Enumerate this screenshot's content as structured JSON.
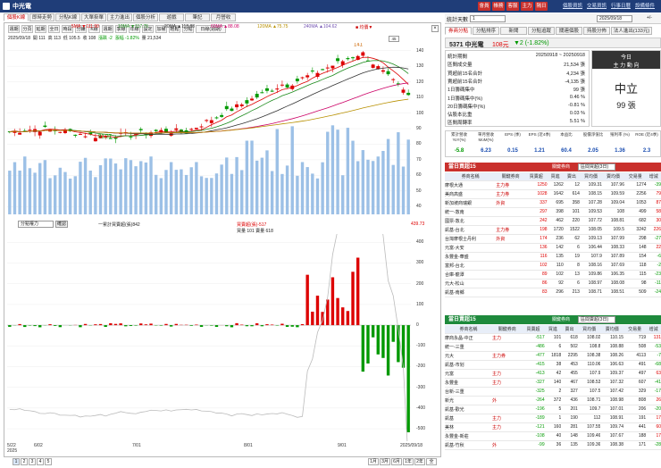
{
  "app": {
    "title": "中光電",
    "tabs_right": [
      "會員",
      "帳務",
      "客服",
      "主力",
      "隔日"
    ],
    "links": [
      "個股資訊",
      "交易資訊",
      "行事日曆",
      "設備條件"
    ]
  },
  "left": {
    "tabs": [
      "個股K線",
      "即時走勢",
      "分點K線",
      "大單掛單",
      "主力進出",
      "個股分析",
      "遊戲",
      "筆記",
      "月營收"
    ],
    "toolbar": [
      "週期",
      "分頁",
      "延期",
      "全日",
      "時段",
      "分鐘",
      "K線",
      "週期",
      "季線",
      "年線",
      "設定",
      "加權",
      "輕鬆",
      "分點",
      "日線(週期)"
    ],
    "ma": [
      {
        "t": "5MA ▼111.90",
        "c": "#d00"
      },
      {
        "t": "10MA ▼117.75",
        "c": "#1a8a1a"
      },
      {
        "t": "20MA ▲118.88",
        "c": "#333"
      },
      {
        "t": "60MA ▲88.08",
        "c": "#c06"
      },
      {
        "t": "120MA ▲75.75",
        "c": "#b89000"
      },
      {
        "t": "240MA ▲104.62",
        "c": "#7050b0"
      }
    ],
    "legend_extra": "■ 均價▼",
    "info": {
      "date": "2025/09/18",
      "open": "開 111",
      "high": "高 113",
      "low": "低 105.5",
      "close": "收 108",
      "change": "漲跌 -2",
      "pct": "漲幅 -1.82%",
      "vol": "量 21,534"
    },
    "zoom": "45",
    "peak_label": "141",
    "low_label": "91.37",
    "price_axis": [
      "140",
      "130",
      "120",
      "110",
      "100",
      "90",
      "80",
      "70",
      "60",
      "50",
      "40"
    ],
    "sub": {
      "sel": "分點權力",
      "btn": "確認",
      "legend1": "一累計買賣超(張)842",
      "legend2": "買賣超(張)-517",
      "legend3": "買量 101  賣量 618",
      "rlabel": "439.73"
    },
    "sub_axis": [
      "400",
      "300",
      "200",
      "100",
      "0",
      "-100",
      "-200",
      "-300",
      "-400",
      "-500"
    ],
    "x_labels": [
      "5/22\n2025",
      "6/02",
      "7/01",
      "8/01",
      "9/01",
      "2025/09/18"
    ],
    "pager": [
      "1",
      "2",
      "3",
      "4",
      "5"
    ],
    "bottom_btns": [
      "1月",
      "3月",
      "6月",
      "1年",
      "2年",
      "全"
    ]
  },
  "right": {
    "code_lbl": "統計天數",
    "code_val": "1",
    "date": "2025/09/18",
    "date_end": "+/-",
    "tabs": [
      "券商分點",
      "分點排序",
      "新聞",
      "分點追蹤",
      "關連個股",
      "持股分佈",
      "法人進出(133元)"
    ],
    "stock": {
      "name": "5371 中光電",
      "price": "108元",
      "chg": "▼2 (-1.82%)"
    },
    "stat_rows": [
      [
        "統計期間",
        "20250918 ~ 20250918"
      ],
      [
        "區間成交量",
        "21,534 張"
      ],
      [
        "買超前15名合計",
        "4,234 張"
      ],
      [
        "賣超前15名合計",
        "-4,135 張"
      ],
      [
        "1日籌碼集中",
        "99 張"
      ],
      [
        "1日籌碼集中(%)",
        "0.46 %"
      ],
      [
        "20日籌碼集中(%)",
        "-0.81 %"
      ],
      [
        "佔股本比重",
        "0.03 %"
      ],
      [
        "區間周轉率",
        "5.51 %"
      ]
    ],
    "today": {
      "h1": "今日",
      "h2": "主 力 動 向",
      "main": "中立",
      "sub": "99 張"
    },
    "kpi_h": [
      "累計營收 YoY(%)",
      "單月營收 MoM(%)",
      "EPS (季)",
      "EPS (近4季)",
      "本益比",
      "股價淨值比",
      "殖利率 (%)",
      "ROE (近4季)"
    ],
    "kpi_v": [
      "-5.8",
      "6.23",
      "0.15",
      "1.21",
      "60.4",
      "2.05",
      "1.36",
      "2.3"
    ],
    "buy": {
      "title": "當日買超15",
      "sel_lbl": "關鍵券商",
      "sel": "區間買超(3日)",
      "cols": [
        "券商名稱",
        "關鍵券商",
        "買賣超",
        "買進",
        "賣出",
        "買均價",
        "賣均價",
        "交易量",
        "增減"
      ],
      "rows": [
        [
          "摩根大通",
          "主力券",
          "1250",
          "1262",
          "12",
          "109.31",
          "107.96",
          "1274",
          "-39"
        ],
        [
          "美商高盛",
          "主力券",
          "1028",
          "1642",
          "614",
          "108.15",
          "109.59",
          "2256",
          "79"
        ],
        [
          "新加坡商瑞銀",
          "外資",
          "337",
          "695",
          "358",
          "107.28",
          "109.04",
          "1053",
          "87"
        ],
        [
          "統一-敦南",
          "",
          "297",
          "398",
          "101",
          "109.53",
          "108",
          "499",
          "58"
        ],
        [
          "國票-敦北",
          "",
          "242",
          "462",
          "220",
          "107.72",
          "108.81",
          "682",
          "30"
        ],
        [
          "凱基-台北",
          "主力券",
          "198",
          "1720",
          "1522",
          "108.05",
          "109.5",
          "3242",
          "226"
        ],
        [
          "台灣摩根士丹利",
          "外資",
          "174",
          "236",
          "62",
          "109.13",
          "107.99",
          "298",
          "-27"
        ],
        [
          "元富-大安",
          "",
          "136",
          "142",
          "6",
          "106.44",
          "108.33",
          "148",
          "22"
        ],
        [
          "永豐金-華盛",
          "",
          "116",
          "135",
          "19",
          "107.9",
          "107.89",
          "154",
          "-6"
        ],
        [
          "富邦-台北",
          "",
          "102",
          "110",
          "8",
          "108.16",
          "107.69",
          "118",
          "-2"
        ],
        [
          "合庫-龍潭",
          "",
          "89",
          "102",
          "13",
          "109.86",
          "106.35",
          "115",
          "-23"
        ],
        [
          "元大-松山",
          "",
          "86",
          "92",
          "6",
          "108.97",
          "108.08",
          "98",
          "-11"
        ],
        [
          "凱基-南鄉",
          "",
          "83",
          "296",
          "213",
          "108.71",
          "108.51",
          "509",
          "-24"
        ]
      ]
    },
    "sell": {
      "title": "當日賣超15",
      "sel_lbl": "關鍵券商",
      "sel": "區間賣超(3日)",
      "cols": [
        "券商名稱",
        "關鍵券商",
        "買賣超",
        "買進",
        "賣出",
        "買均價",
        "賣均價",
        "交易量",
        "增減"
      ],
      "rows": [
        [
          "摩商永晶-中正",
          "主力",
          "-517",
          "101",
          "618",
          "108.02",
          "110.15",
          "719",
          "131"
        ],
        [
          "統一-三重",
          "",
          "-486",
          "6",
          "502",
          "108.8",
          "108.88",
          "508",
          "-53"
        ],
        [
          "元大",
          "主力券",
          "-477",
          "1818",
          "2295",
          "108.38",
          "108.26",
          "4113",
          "-7"
        ],
        [
          "凱基-市划",
          "",
          "-415",
          "38",
          "453",
          "110.06",
          "106.63",
          "491",
          "-68"
        ],
        [
          "元富",
          "主力",
          "-413",
          "42",
          "455",
          "107.9",
          "109.37",
          "497",
          "63"
        ],
        [
          "永豐金",
          "主力",
          "-327",
          "140",
          "467",
          "108.53",
          "107.32",
          "607",
          "-41"
        ],
        [
          "台新-三重",
          "",
          "-325",
          "2",
          "327",
          "107.5",
          "107.42",
          "329",
          "-17"
        ],
        [
          "新光",
          "外",
          "-264",
          "372",
          "436",
          "108.71",
          "108.98",
          "808",
          "26"
        ],
        [
          "凱基-歡光",
          "",
          "-196",
          "5",
          "201",
          "109.7",
          "107.01",
          "206",
          "-20"
        ],
        [
          "凱基",
          "主力",
          "-189",
          "1",
          "190",
          "112",
          "108.91",
          "191",
          "17"
        ],
        [
          "美林",
          "主力",
          "-121",
          "160",
          "281",
          "107.55",
          "109.74",
          "441",
          "60"
        ],
        [
          "永豐金-新莊",
          "",
          "-108",
          "40",
          "148",
          "109.46",
          "107.67",
          "188",
          "17"
        ],
        [
          "凱基-竹秋",
          "外",
          "-99",
          "36",
          "135",
          "109.36",
          "108.38",
          "171",
          "-28"
        ]
      ]
    }
  }
}
